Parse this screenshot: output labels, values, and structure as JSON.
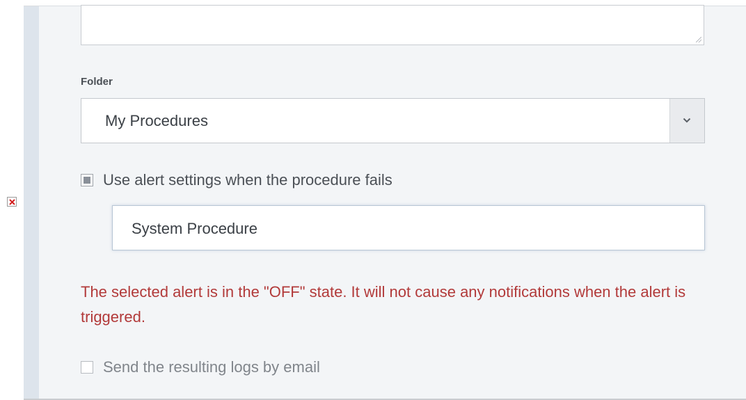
{
  "form": {
    "folder_label": "Folder",
    "folder_value": "My Procedures",
    "use_alert_label": "Use alert settings when the procedure fails",
    "use_alert_checked": true,
    "alert_value": "System Procedure",
    "warning_text": "The selected alert is in the \"OFF\" state. It will not cause any notifications when the alert is triggered.",
    "send_logs_label": "Send the resulting logs by email",
    "send_logs_checked": false
  },
  "colors": {
    "warning": "#b23a3a",
    "panel_bg": "#f3f5f7",
    "accent_bar": "#dde4ec"
  },
  "icons": {
    "broken_image": "broken-image-icon",
    "dropdown": "chevron-down-icon",
    "resize": "resize-grip-icon"
  }
}
